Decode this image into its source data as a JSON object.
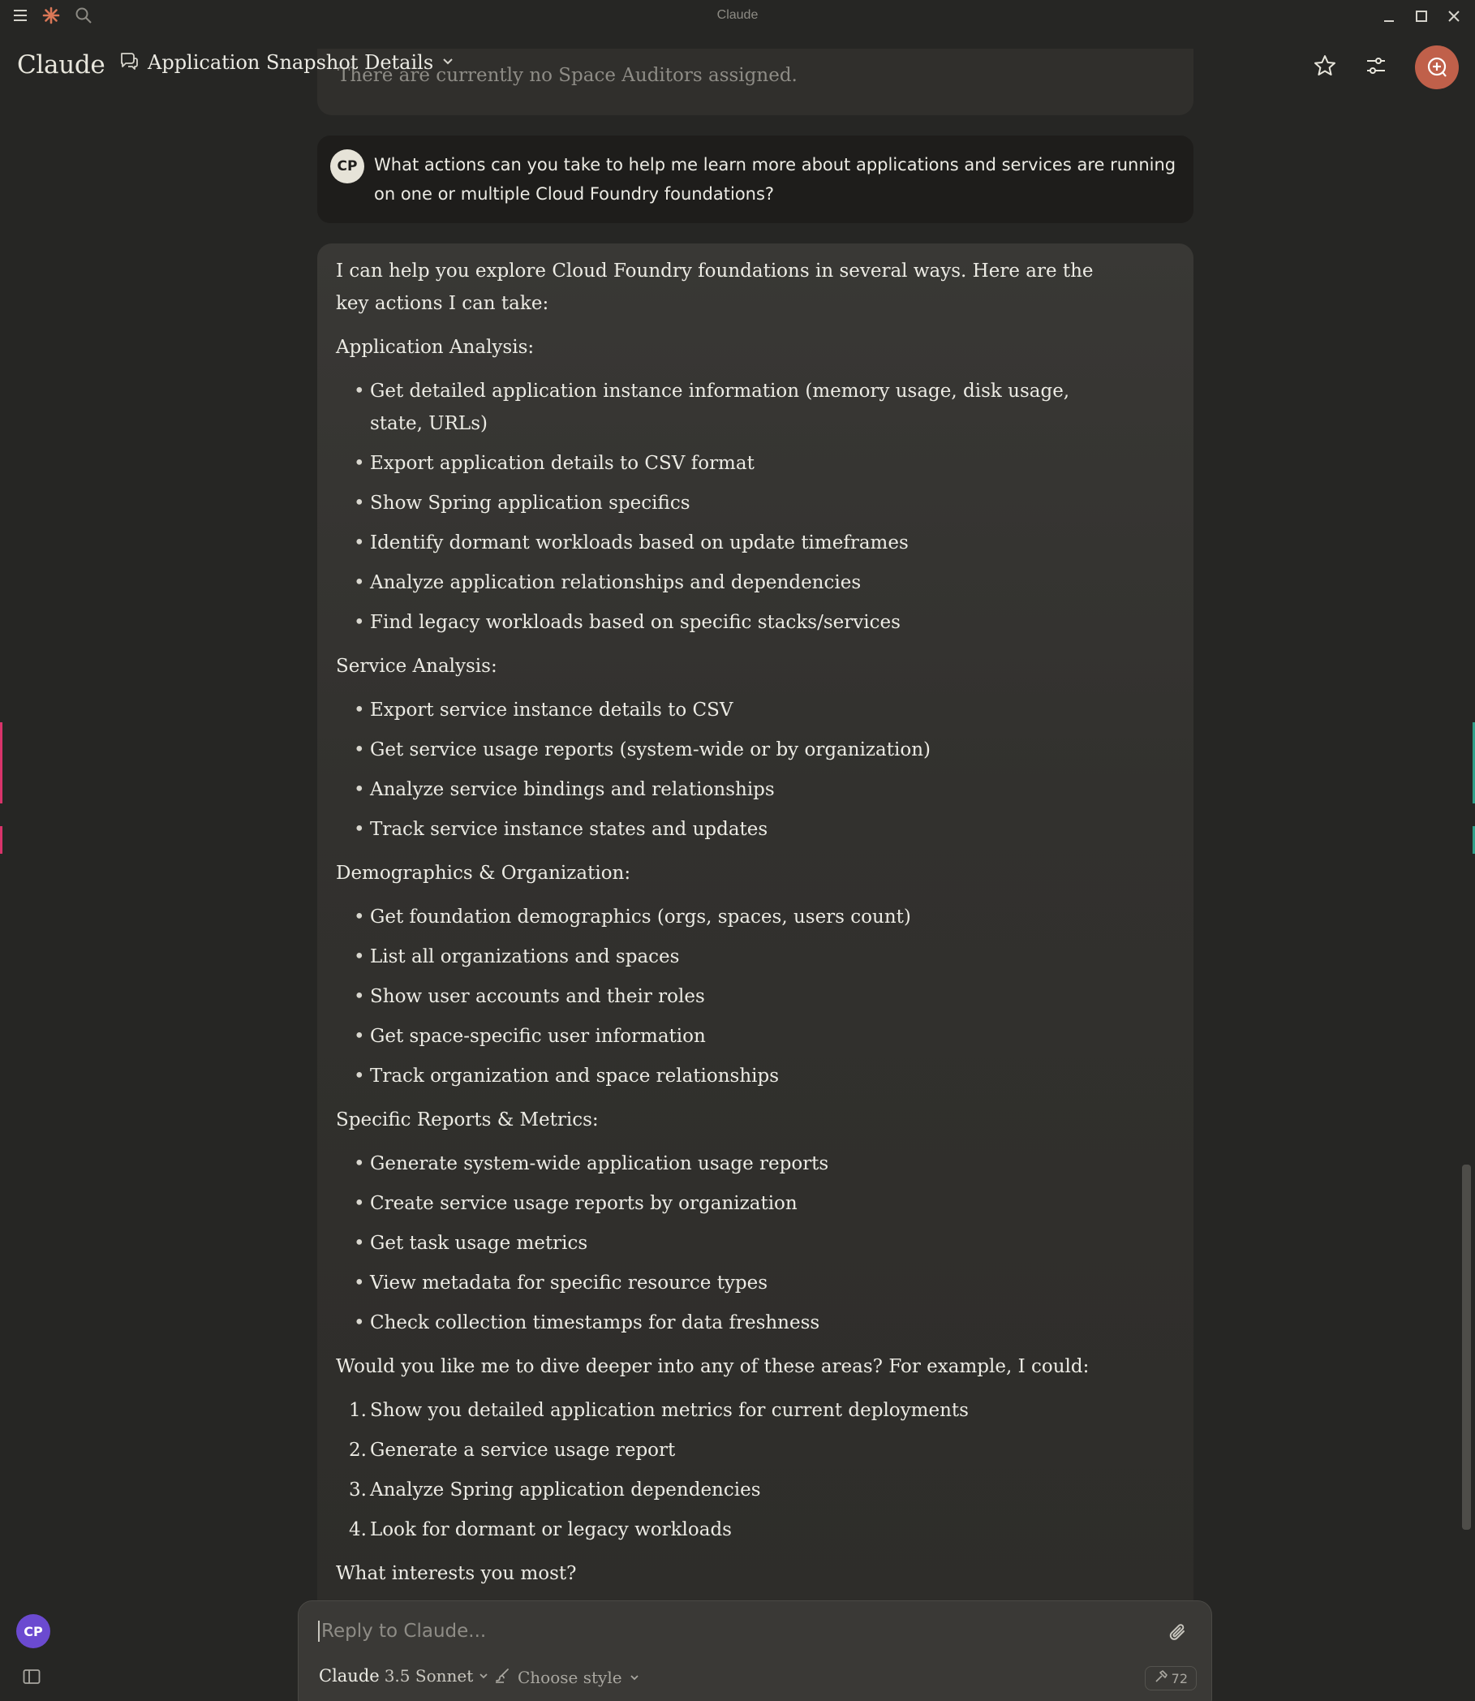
{
  "os": {
    "title": "Claude"
  },
  "header": {
    "brand": "Claude",
    "conversation_title": "Application Snapshot Details"
  },
  "previous_message_tail": "There are currently no Space Auditors assigned.",
  "user_message": {
    "avatar_initials": "CP",
    "text": "What actions can you take to help me learn more about applications and services are running on one or multiple Cloud Foundry foundations?"
  },
  "assistant_message": {
    "intro": "I can help you explore Cloud Foundry foundations in several ways. Here are the key actions I can take:",
    "sections": [
      {
        "heading": "Application Analysis:",
        "items": [
          "Get detailed application instance information (memory usage, disk usage, state, URLs)",
          "Export application details to CSV format",
          "Show Spring application specifics",
          "Identify dormant workloads based on update timeframes",
          "Analyze application relationships and dependencies",
          "Find legacy workloads based on specific stacks/services"
        ]
      },
      {
        "heading": "Service Analysis:",
        "items": [
          "Export service instance details to CSV",
          "Get service usage reports (system-wide or by organization)",
          "Analyze service bindings and relationships",
          "Track service instance states and updates"
        ]
      },
      {
        "heading": "Demographics & Organization:",
        "items": [
          "Get foundation demographics (orgs, spaces, users count)",
          "List all organizations and spaces",
          "Show user accounts and their roles",
          "Get space-specific user information",
          "Track organization and space relationships"
        ]
      },
      {
        "heading": "Specific Reports & Metrics:",
        "items": [
          "Generate system-wide application usage reports",
          "Create service usage reports by organization",
          "Get task usage metrics",
          "View metadata for specific resource types",
          "Check collection timestamps for data freshness"
        ]
      }
    ],
    "followup": "Would you like me to dive deeper into any of these areas? For example, I could:",
    "options": [
      {
        "num": "1.",
        "text": "Show you detailed application metrics for current deployments"
      },
      {
        "num": "2.",
        "text": "Generate a service usage report"
      },
      {
        "num": "3.",
        "text": "Analyze Spring application dependencies"
      },
      {
        "num": "4.",
        "text": "Look for dormant or legacy workloads"
      }
    ],
    "closing": "What interests you most?"
  },
  "composer": {
    "placeholder": "Reply to Claude...",
    "model_name": "Claude",
    "model_version": "3.5 Sonnet",
    "style_label": "Choose style",
    "tools_count": "72"
  },
  "sidebar": {
    "user_initials": "CP"
  },
  "icons": {
    "menu": "hamburger-icon",
    "logo": "claude-spark-icon",
    "search": "search-icon",
    "chat": "chat-bubbles-icon",
    "star": "star-icon",
    "settings": "sliders-icon",
    "new_chat": "new-chat-icon",
    "attach": "paperclip-icon",
    "style": "brush-icon",
    "tools": "hammer-icon",
    "sidebar_toggle": "sidebar-toggle-icon"
  },
  "colors": {
    "background": "#262624",
    "accent": "#c0604a",
    "user_bubble": "#1e1d1b",
    "avatar_purple": "#6b4ad0"
  }
}
